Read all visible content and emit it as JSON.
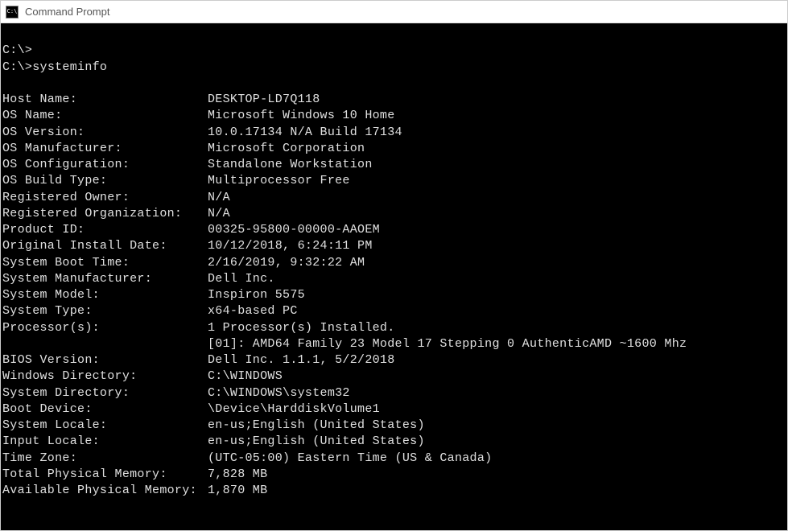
{
  "window": {
    "title": "Command Prompt",
    "icon_label": "C:\\"
  },
  "prompt1": "C:\\>",
  "prompt2": "C:\\>",
  "command": "systeminfo",
  "rows": [
    {
      "label": "Host Name:",
      "value": "DESKTOP-LD7Q118"
    },
    {
      "label": "OS Name:",
      "value": "Microsoft Windows 10 Home"
    },
    {
      "label": "OS Version:",
      "value": "10.0.17134 N/A Build 17134"
    },
    {
      "label": "OS Manufacturer:",
      "value": "Microsoft Corporation"
    },
    {
      "label": "OS Configuration:",
      "value": "Standalone Workstation"
    },
    {
      "label": "OS Build Type:",
      "value": "Multiprocessor Free"
    },
    {
      "label": "Registered Owner:",
      "value": "N/A"
    },
    {
      "label": "Registered Organization:",
      "value": "N/A"
    },
    {
      "label": "Product ID:",
      "value": "00325-95800-00000-AAOEM"
    },
    {
      "label": "Original Install Date:",
      "value": "10/12/2018, 6:24:11 PM"
    },
    {
      "label": "System Boot Time:",
      "value": "2/16/2019, 9:32:22 AM"
    },
    {
      "label": "System Manufacturer:",
      "value": "Dell Inc."
    },
    {
      "label": "System Model:",
      "value": "Inspiron 5575"
    },
    {
      "label": "System Type:",
      "value": "x64-based PC"
    },
    {
      "label": "Processor(s):",
      "value": "1 Processor(s) Installed."
    }
  ],
  "processor_detail": "[01]: AMD64 Family 23 Model 17 Stepping 0 AuthenticAMD ~1600 Mhz",
  "rows2": [
    {
      "label": "BIOS Version:",
      "value": "Dell Inc. 1.1.1, 5/2/2018"
    },
    {
      "label": "Windows Directory:",
      "value": "C:\\WINDOWS"
    },
    {
      "label": "System Directory:",
      "value": "C:\\WINDOWS\\system32"
    },
    {
      "label": "Boot Device:",
      "value": "\\Device\\HarddiskVolume1"
    },
    {
      "label": "System Locale:",
      "value": "en-us;English (United States)"
    },
    {
      "label": "Input Locale:",
      "value": "en-us;English (United States)"
    },
    {
      "label": "Time Zone:",
      "value": "(UTC-05:00) Eastern Time (US & Canada)"
    },
    {
      "label": "Total Physical Memory:",
      "value": "7,828 MB"
    },
    {
      "label": "Available Physical Memory:",
      "value": "1,870 MB"
    }
  ]
}
